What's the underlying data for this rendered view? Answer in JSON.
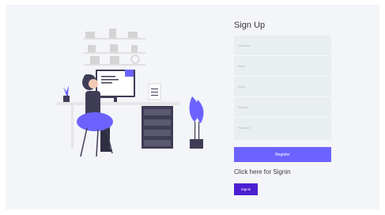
{
  "signup": {
    "title": "Sign Up"
  },
  "fields": [
    {
      "placeholder": "Username"
    },
    {
      "placeholder": "Name"
    },
    {
      "placeholder": "Email"
    },
    {
      "placeholder": "Number"
    },
    {
      "placeholder": "Password"
    }
  ],
  "register_label": "Register",
  "signin_prompt": "Click here for Signin",
  "signin_label": "Signin",
  "colors": {
    "accent": "#6c63ff",
    "signin": "#4b1fd0",
    "form_bg": "#e9eeee",
    "page_bg": "#f4f5f9"
  },
  "illustration": {
    "name": "person-at-desk-illustration"
  }
}
